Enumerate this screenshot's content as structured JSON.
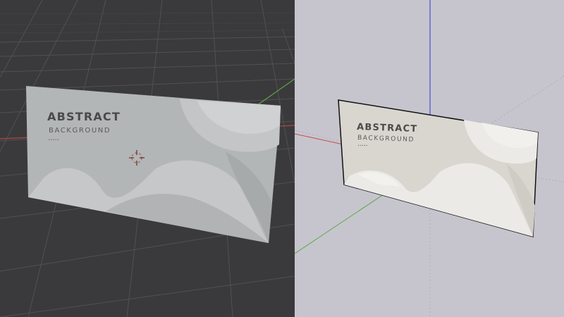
{
  "colors": {
    "left_bg": "#3a3a3c",
    "right_bg": "#c6c5cd",
    "grid_left": "#555557",
    "grid_right": "#a9a8b0",
    "axis_x": "#c84a4a",
    "axis_y": "#62a84a",
    "axis_z": "#4b4bd6",
    "panel_left": "#b4b7b8",
    "panel_right": "#dcdad6",
    "panel_text": "#4a4a4a"
  },
  "left_view": {
    "panel": {
      "title": "ABSTRACT",
      "subtitle": "BACKGROUND",
      "dots": "• • • • •"
    },
    "gizmo_icon": "3d-cursor-icon"
  },
  "right_view": {
    "panel": {
      "title": "ABSTRACT",
      "subtitle": "BACKGROUND",
      "dots": "• • • • •"
    }
  }
}
